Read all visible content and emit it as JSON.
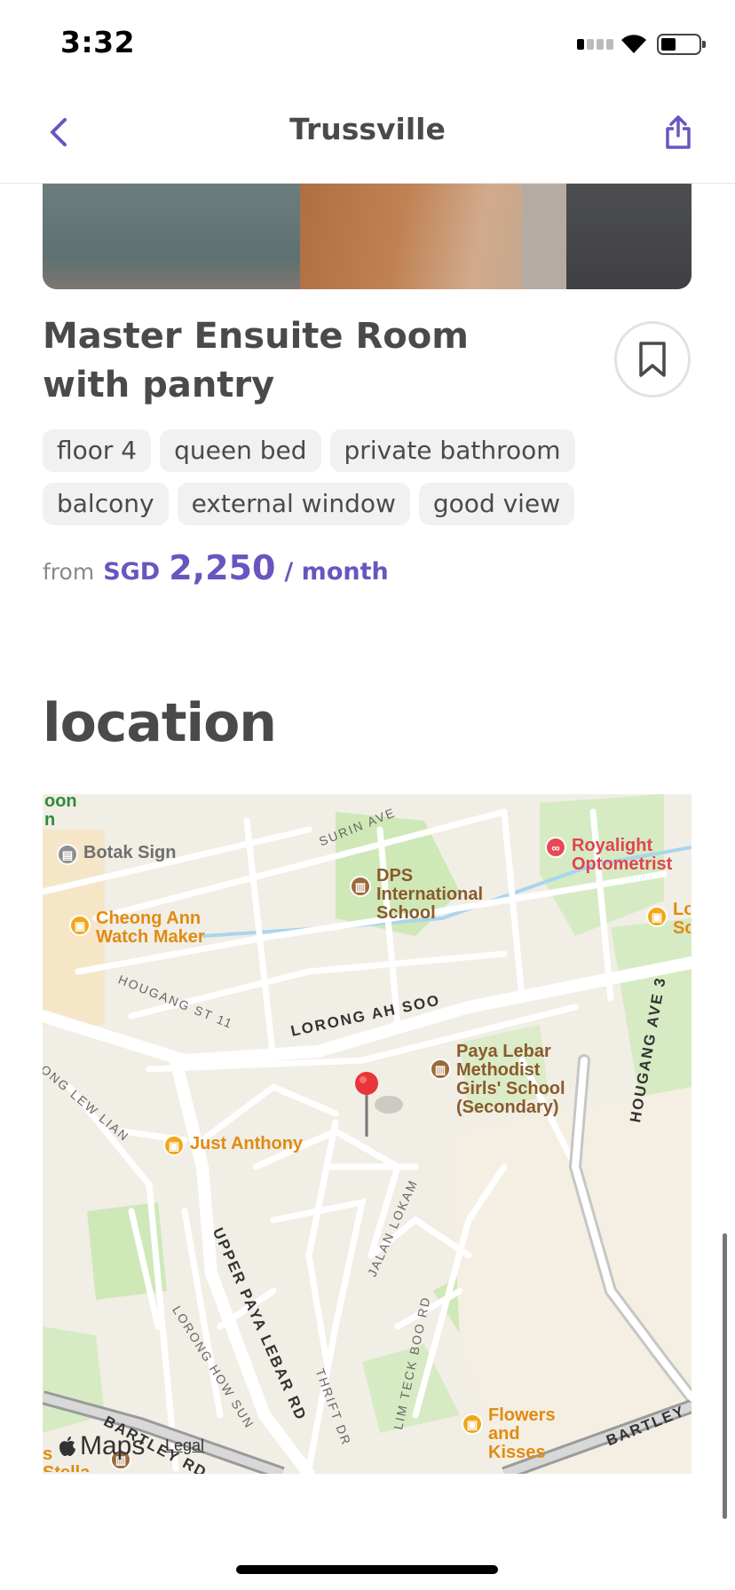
{
  "status_bar": {
    "time": "3:32"
  },
  "nav": {
    "title": "Trussville"
  },
  "listing": {
    "title_line1": "Master Ensuite Room",
    "title_line2": "with pantry",
    "tags": [
      "floor 4",
      "queen bed",
      "private bathroom",
      "balcony",
      "external window",
      "good view"
    ],
    "price": {
      "from": "from",
      "currency": "SGD",
      "amount": "2,250",
      "unit": "/ month"
    }
  },
  "location": {
    "title": "location",
    "map": {
      "pois": {
        "botak": "Botak Sign",
        "royalight": "Royalight Optometrist",
        "dps": "DPS International School",
        "cheong": "Cheong Ann Watch Maker",
        "paya": "Paya Lebar Methodist Girls' School (Secondary)",
        "anthony": "Just Anthony",
        "flowers": "Flowers and Kisses",
        "stella": "s Stella School",
        "edge_top": "oon n",
        "edge_right": "Lo Sc"
      },
      "roads": {
        "surin": "SURIN AVE",
        "hougang11": "HOUGANG ST 11",
        "ahsoo": "LORONG AH SOO",
        "lewlian": "ONG LEW LIAN",
        "hougang3": "HOUGANG AVE 3",
        "upl": "UPPER PAYA LEBAR RD",
        "howsun": "LORONG HOW SUN",
        "lokam": "JALAN LOKAM",
        "thrift": "THRIFT DR",
        "limteck": "LIM TECK BOO RD",
        "bartley": "BARTLEY RD",
        "bartley_r": "BARTLEY"
      },
      "brand": "Maps",
      "legal": "Legal"
    }
  },
  "colors": {
    "accent": "#6a55c0",
    "text": "#4a4a4a",
    "tag_bg": "#f1f1f1"
  }
}
